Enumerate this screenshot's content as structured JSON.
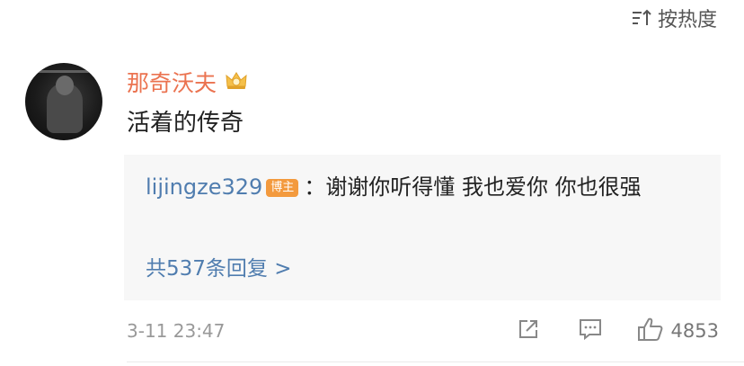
{
  "sort": {
    "label": "按热度",
    "icon": "sort-icon"
  },
  "comment": {
    "username": "那奇沃夫",
    "crown_icon": "crown-badge-icon",
    "text": "活着的传奇",
    "date": "3-11 23:47",
    "likes": "4853"
  },
  "reply": {
    "user": "lijingze329",
    "badge": "博主",
    "separator": "：",
    "text": "谢谢你听得懂 我也爱你 你也很强",
    "more": "共537条回复 >"
  },
  "colors": {
    "username": "#eb7350",
    "link": "#507daf",
    "badge": "#f39a3e",
    "reply_bg": "#f7f7f7"
  }
}
